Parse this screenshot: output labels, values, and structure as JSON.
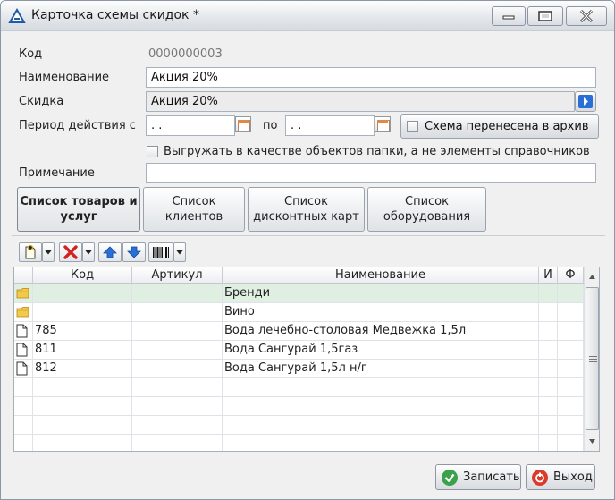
{
  "window": {
    "title": "Карточка схемы скидок *"
  },
  "form": {
    "code_label": "Код",
    "code_value": "0000000003",
    "name_label": "Наименование",
    "name_value": "Акция 20%",
    "discount_label": "Скидка",
    "discount_value": "Акция 20%",
    "period_label": "Период действия с",
    "period_from": " .  .",
    "period_to_label": "по",
    "period_to": " .  .",
    "archive_label": "Схема перенесена в архив",
    "export_label": "Выгружать в качестве объектов папки, а не элементы справочников",
    "note_label": "Примечание",
    "note_value": ""
  },
  "tabs": [
    {
      "line1": "Список товаров и",
      "line2": "услуг",
      "active": true
    },
    {
      "line1": "Список",
      "line2": "клиентов",
      "active": false
    },
    {
      "line1": "Список",
      "line2": "дисконтных карт",
      "active": false
    },
    {
      "line1": "Список",
      "line2": "оборудования",
      "active": false
    }
  ],
  "toolbar": {
    "icons": [
      "add-icon",
      "delete-icon",
      "move-up-icon",
      "move-down-icon",
      "barcode-icon"
    ]
  },
  "grid": {
    "columns": [
      "Код",
      "Артикул",
      "Наименование",
      "И",
      "Ф"
    ],
    "rows": [
      {
        "type": "folder",
        "code": "",
        "article": "",
        "name": "Бренди"
      },
      {
        "type": "folder",
        "code": "",
        "article": "",
        "name": "Вино"
      },
      {
        "type": "item",
        "code": "785",
        "article": "",
        "name": "Вода лечебно-столовая Медвежка 1,5л"
      },
      {
        "type": "item",
        "code": "811",
        "article": "",
        "name": "Вода Сангурай 1,5газ"
      },
      {
        "type": "item",
        "code": "812",
        "article": "",
        "name": "Вода Сангурай 1,5л н/г"
      }
    ]
  },
  "footer": {
    "save_label": "Записать",
    "exit_label": "Выход"
  },
  "colors": {
    "selected_row": "#dff0e3",
    "accent_blue": "#2a6fd6",
    "delete_red": "#d42020"
  }
}
